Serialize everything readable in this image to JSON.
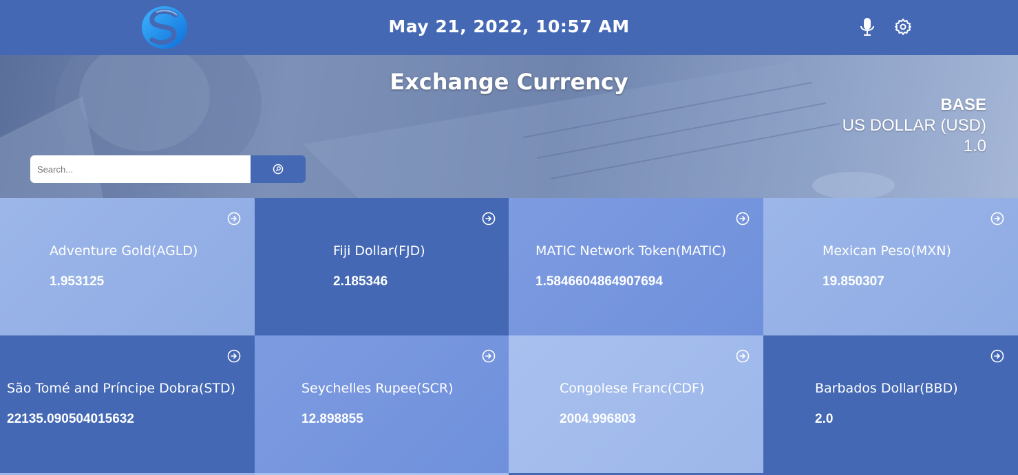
{
  "header": {
    "datetime": "May 21, 2022, 10:57 AM",
    "logo_icon": "swirl-logo-icon",
    "mic_icon": "microphone-icon",
    "settings_icon": "gear-icon"
  },
  "hero": {
    "title": "Exchange Currency",
    "base_label": "BASE",
    "base_currency": "US DOLLAR (USD)",
    "base_value": "1.0"
  },
  "search": {
    "placeholder": "Search...",
    "button_icon": "search-icon"
  },
  "colors": {
    "primary": "#4468b4",
    "tile_mid": "#7d9be0",
    "tile_light": "#9cb6e9"
  },
  "cards": [
    {
      "name": "Adventure Gold(AGLD)",
      "rate": "1.953125"
    },
    {
      "name": "Fiji Dollar(FJD)",
      "rate": "2.185346"
    },
    {
      "name": "MATIC Network Token(MATIC)",
      "rate": "1.5846604864907694"
    },
    {
      "name": "Mexican Peso(MXN)",
      "rate": "19.850307"
    },
    {
      "name": "São Tomé and Príncipe Dobra(STD)",
      "rate": "22135.090504015632"
    },
    {
      "name": "Seychelles Rupee(SCR)",
      "rate": "12.898855"
    },
    {
      "name": "Congolese Franc(CDF)",
      "rate": "2004.996803"
    },
    {
      "name": "Barbados Dollar(BBD)",
      "rate": "2.0"
    }
  ],
  "card_icon": "arrow-right-circle-icon"
}
